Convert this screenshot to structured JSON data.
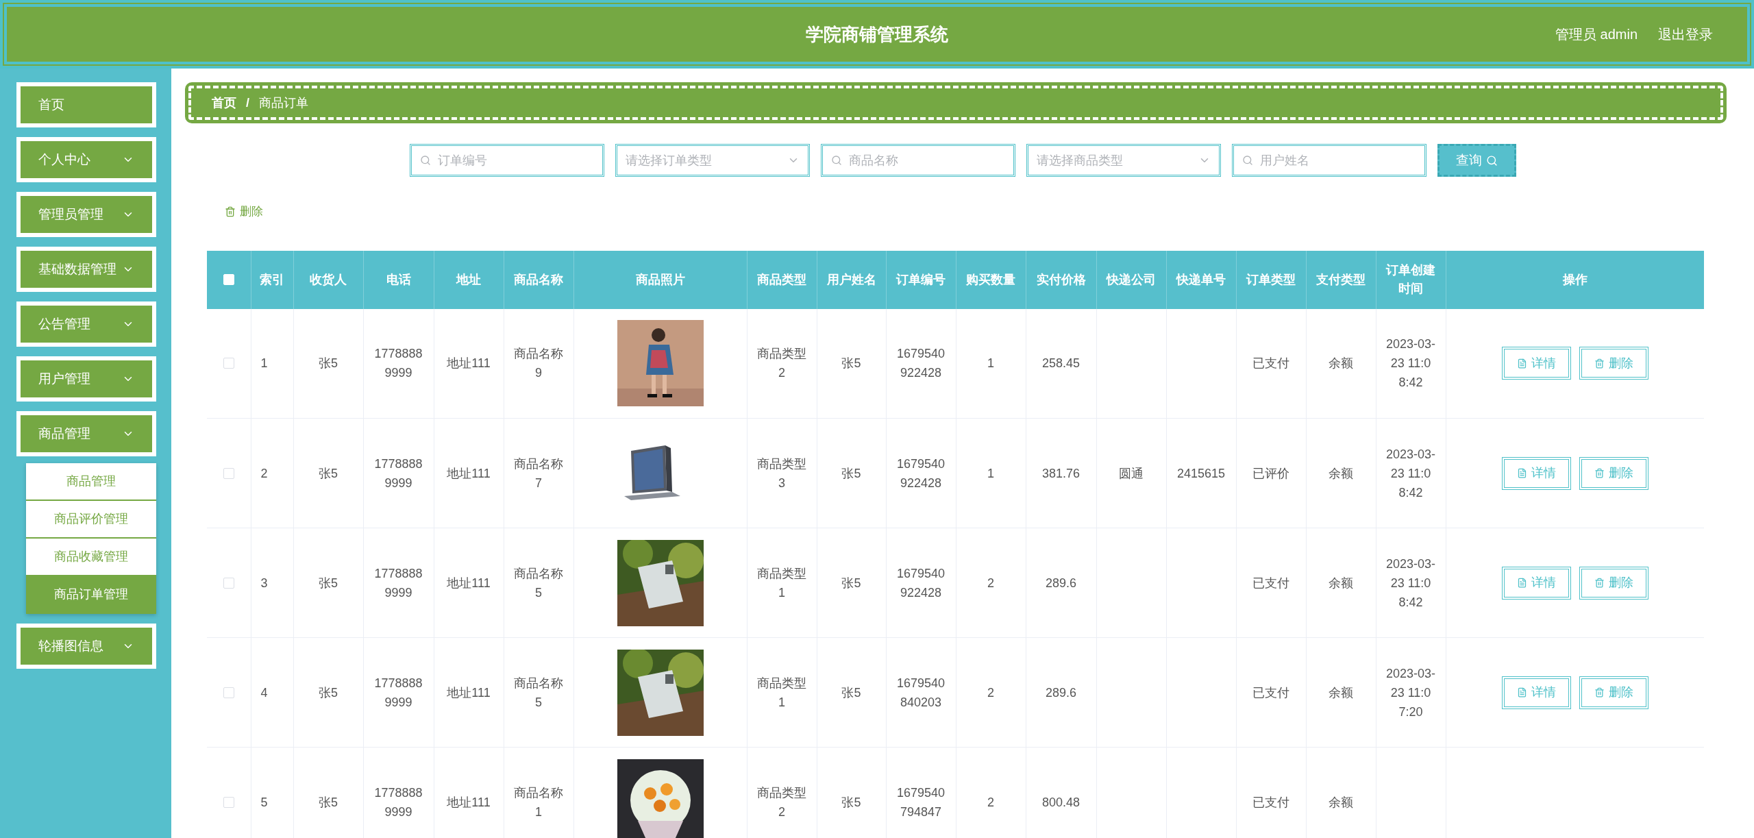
{
  "header": {
    "title": "学院商铺管理系统",
    "user": "管理员 admin",
    "logout": "退出登录"
  },
  "sidebar": {
    "items": [
      {
        "label": "首页",
        "expandable": false,
        "selected": false
      },
      {
        "label": "个人中心",
        "expandable": true,
        "selected": false
      },
      {
        "label": "管理员管理",
        "expandable": true,
        "selected": false
      },
      {
        "label": "基础数据管理",
        "expandable": true,
        "selected": false
      },
      {
        "label": "公告管理",
        "expandable": true,
        "selected": false
      },
      {
        "label": "用户管理",
        "expandable": true,
        "selected": false
      },
      {
        "label": "商品管理",
        "expandable": true,
        "selected": false,
        "children": [
          {
            "label": "商品管理",
            "selected": false
          },
          {
            "label": "商品评价管理",
            "selected": false
          },
          {
            "label": "商品收藏管理",
            "selected": false
          },
          {
            "label": "商品订单管理",
            "selected": true
          }
        ]
      },
      {
        "label": "轮播图信息",
        "expandable": true,
        "selected": false
      }
    ]
  },
  "breadcrumb": {
    "separator": "/",
    "items": [
      {
        "label": "首页"
      },
      {
        "label": "商品订单"
      }
    ]
  },
  "filters": [
    {
      "kind": "input",
      "placeholder": "订单编号"
    },
    {
      "kind": "select",
      "placeholder": "请选择订单类型"
    },
    {
      "kind": "input",
      "placeholder": "商品名称"
    },
    {
      "kind": "select",
      "placeholder": "请选择商品类型"
    },
    {
      "kind": "input",
      "placeholder": "用户姓名"
    }
  ],
  "search_button": "查询",
  "delete_button": "删除",
  "table": {
    "select_all_checked": false,
    "columns": [
      "索引",
      "收货人",
      "电话",
      "地址",
      "商品名称",
      "商品照片",
      "商品类型",
      "用户姓名",
      "订单编号",
      "购买数量",
      "实付价格",
      "快递公司",
      "快递单号",
      "订单类型",
      "支付类型",
      "订单创建时间",
      "操作"
    ],
    "rows": [
      {
        "checked": false,
        "cells": [
          "1",
          "张5",
          "17788889999",
          "地址111",
          "商品名称9",
          null,
          "商品类型2",
          "张5",
          "1679540922428",
          "1",
          "258.45",
          "",
          "",
          "已支付",
          "余额",
          "2023-03-23 11:08:42"
        ],
        "actions": [
          "详情",
          "删除"
        ]
      },
      {
        "checked": false,
        "cells": [
          "2",
          "张5",
          "17788889999",
          "地址111",
          "商品名称7",
          null,
          "商品类型3",
          "张5",
          "1679540922428",
          "1",
          "381.76",
          "圆通",
          "2415615",
          "已评价",
          "余额",
          "2023-03-23 11:08:42"
        ],
        "actions": [
          "详情",
          "删除"
        ]
      },
      {
        "checked": false,
        "cells": [
          "3",
          "张5",
          "17788889999",
          "地址111",
          "商品名称5",
          null,
          "商品类型1",
          "张5",
          "1679540922428",
          "2",
          "289.6",
          "",
          "",
          "已支付",
          "余额",
          "2023-03-23 11:08:42"
        ],
        "actions": [
          "详情",
          "删除"
        ]
      },
      {
        "checked": false,
        "cells": [
          "4",
          "张5",
          "17788889999",
          "地址111",
          "商品名称5",
          null,
          "商品类型1",
          "张5",
          "1679540840203",
          "2",
          "289.6",
          "",
          "",
          "已支付",
          "余额",
          "2023-03-23 11:07:20"
        ],
        "actions": [
          "详情",
          "删除"
        ]
      },
      {
        "checked": false,
        "cells": [
          "5",
          "张5",
          "17788889999",
          "地址111",
          "商品名称1",
          null,
          "商品类型2",
          "张5",
          "1679540794847",
          "2",
          "800.48",
          "",
          "",
          "已支付",
          "余额"
        ],
        "actions": []
      }
    ]
  }
}
